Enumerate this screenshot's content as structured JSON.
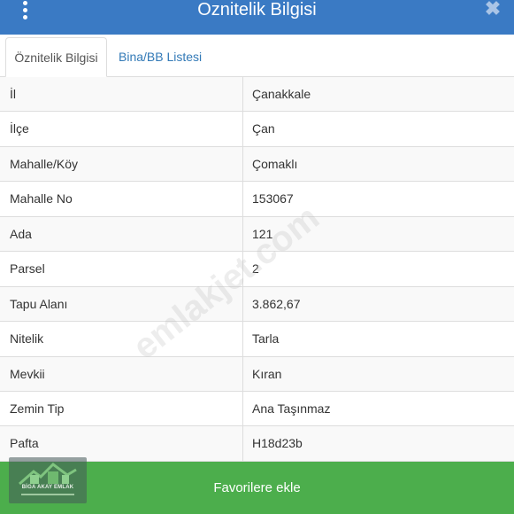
{
  "header": {
    "title": "Oznitelik Bilgisi",
    "menu_icon": "vertical-dots-icon",
    "close_icon": "close-icon",
    "close_glyph": "✖",
    "accent_color": "#3a7ac4"
  },
  "tabs": [
    {
      "label": "Öznitelik Bilgisi",
      "active": true
    },
    {
      "label": "Bina/BB Listesi",
      "active": false
    }
  ],
  "rows": [
    {
      "key": "İl",
      "value": "Çanakkale"
    },
    {
      "key": "İlçe",
      "value": "Çan"
    },
    {
      "key": "Mahalle/Köy",
      "value": "Çomaklı"
    },
    {
      "key": "Mahalle No",
      "value": "153067"
    },
    {
      "key": "Ada",
      "value": "121"
    },
    {
      "key": "Parsel",
      "value": "2"
    },
    {
      "key": "Tapu Alanı",
      "value": "3.862,67"
    },
    {
      "key": "Nitelik",
      "value": "Tarla"
    },
    {
      "key": "Mevkii",
      "value": "Kıran"
    },
    {
      "key": "Zemin Tip",
      "value": "Ana Taşınmaz"
    },
    {
      "key": "Pafta",
      "value": "H18d23b"
    }
  ],
  "watermark": "emlakjet.com",
  "footer": {
    "button_label": "Favorilere ekle",
    "button_color": "#4cae4c"
  },
  "logo": {
    "text": "BİGA AKAY EMLAK",
    "icon": "house-logo-icon"
  }
}
